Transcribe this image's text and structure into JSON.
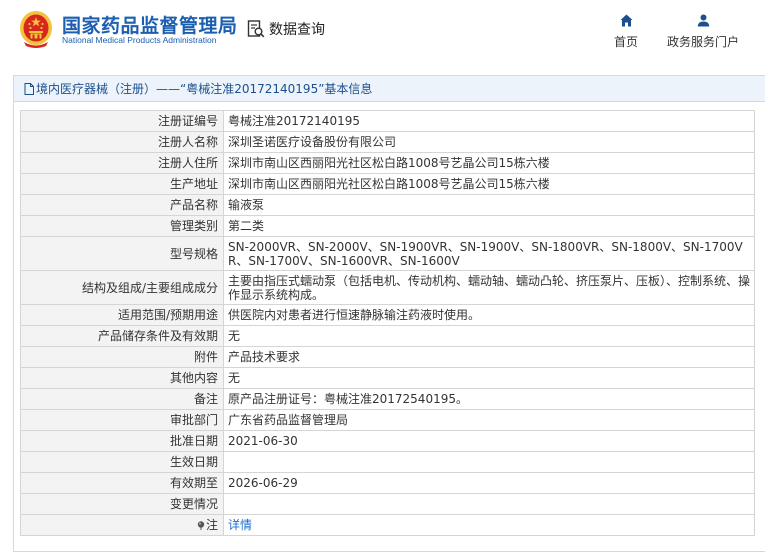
{
  "header": {
    "logo_cn": "国家药品监督管理局",
    "logo_en": "National Medical Products Administration",
    "query_label": "数据查询",
    "nav_home": "首页",
    "nav_portal": "政务服务门户"
  },
  "panel": {
    "title": "境内医疗器械（注册）——“粤械注准20172140195”基本信息"
  },
  "rows": [
    {
      "key": "注册证编号",
      "value": "粤械注准20172140195"
    },
    {
      "key": "注册人名称",
      "value": "深圳圣诺医疗设备股份有限公司"
    },
    {
      "key": "注册人住所",
      "value": "深圳市南山区西丽阳光社区松白路1008号艺晶公司15栋六楼"
    },
    {
      "key": "生产地址",
      "value": "深圳市南山区西丽阳光社区松白路1008号艺晶公司15栋六楼"
    },
    {
      "key": "产品名称",
      "value": "输液泵"
    },
    {
      "key": "管理类别",
      "value": "第二类"
    },
    {
      "key": "型号规格",
      "value": "SN-2000VR、SN-2000V、SN-1900VR、SN-1900V、SN-1800VR、SN-1800V、SN-1700VR、SN-1700V、SN-1600VR、SN-1600V"
    },
    {
      "key": "结构及组成/主要组成成分",
      "value": "主要由指压式蠕动泵（包括电机、传动机构、蠕动轴、蠕动凸轮、挤压泵片、压板）、控制系统、操作显示系统构成。"
    },
    {
      "key": "适用范围/预期用途",
      "value": "供医院内对患者进行恒速静脉输注药液时使用。"
    },
    {
      "key": "产品储存条件及有效期",
      "value": "无"
    },
    {
      "key": "附件",
      "value": "产品技术要求"
    },
    {
      "key": "其他内容",
      "value": "无"
    },
    {
      "key": "备注",
      "value": "原产品注册证号：粤械注准20172540195。"
    },
    {
      "key": "审批部门",
      "value": "广东省药品监督管理局"
    },
    {
      "key": "批准日期",
      "value": "2021-06-30"
    },
    {
      "key": "生效日期",
      "value": ""
    },
    {
      "key": "有效期至",
      "value": "2026-06-29"
    },
    {
      "key": "变更情况",
      "value": ""
    },
    {
      "key": "注",
      "value": "详情"
    }
  ],
  "colors": {
    "brand_blue": "#1c5fb0",
    "link_blue": "#1c6fd0",
    "emblem_red": "#d7261e",
    "emblem_gold": "#f3c33c"
  }
}
